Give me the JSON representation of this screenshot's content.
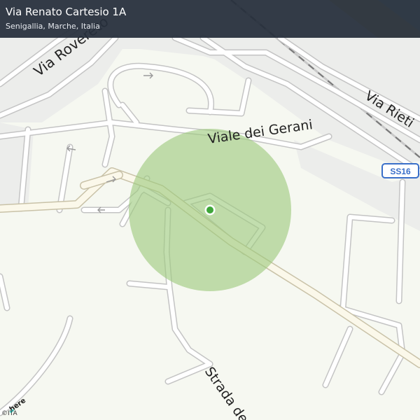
{
  "header": {
    "title": "Via Renato Cartesio 1A",
    "subtitle": "Senigallia, Marche, Italia"
  },
  "map": {
    "road_labels": {
      "via_rovereto": "Via Rovereto",
      "viale_dei_gerani": "Viale  dei Gerani",
      "via_rieti": "Via  Rieti",
      "strada_de": "Strada de"
    },
    "route_shield": "SS16",
    "location_marker": "location-pin",
    "accuracy_circle_color": "#9cc97c",
    "marker_color": "#3fa63a",
    "park_color": "#f6f8f1",
    "block_color": "#ecedeb",
    "beach_color": "#f6e6a1"
  },
  "attribution": {
    "logo_text": "here",
    "copyright": "©ITA"
  }
}
